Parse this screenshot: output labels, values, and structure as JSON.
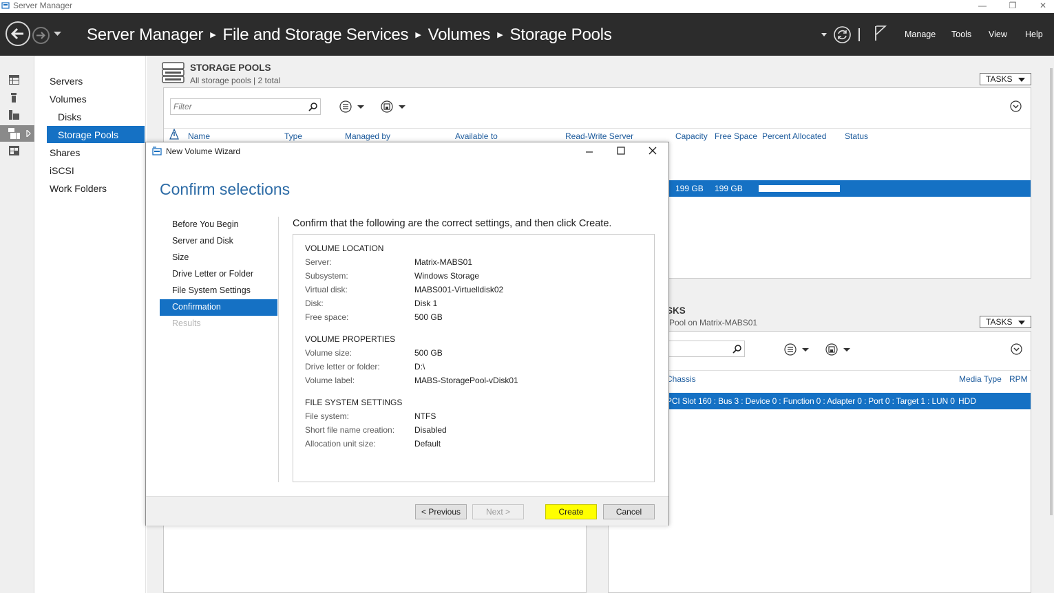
{
  "window": {
    "title": "Server Manager",
    "controls": [
      "—",
      "❐",
      "✕"
    ]
  },
  "header": {
    "breadcrumb": [
      "Server Manager",
      "File and Storage Services",
      "Volumes",
      "Storage Pools"
    ],
    "menus": [
      "Manage",
      "Tools",
      "View",
      "Help"
    ]
  },
  "nav": {
    "items": [
      "Servers",
      "Volumes",
      "Disks",
      "Storage Pools",
      "Shares",
      "iSCSI",
      "Work Folders"
    ],
    "selected": "Storage Pools"
  },
  "storage_pools": {
    "title": "STORAGE POOLS",
    "subtitle": "All storage pools | 2 total",
    "tasks_label": "TASKS",
    "filter_placeholder": "Filter",
    "columns": [
      "Name",
      "Type",
      "Managed by",
      "Available to",
      "Read-Write Server",
      "Capacity",
      "Free Space",
      "Percent Allocated",
      "Status"
    ],
    "selected_row": {
      "capacity": "199 GB",
      "free_space": "199 GB",
      "percent_allocated": 1.0
    }
  },
  "physical_disks": {
    "title_fragment": "SKS",
    "subtitle_fragment": "Pool on Matrix-MABS01",
    "tasks_label": "TASKS",
    "columns": [
      "Chassis",
      "Media Type",
      "RPM"
    ],
    "row": {
      "chassis": "PCI Slot 160 : Bus 3 : Device 0 : Function 0 : Adapter 0 : Port 0 : Target 1 : LUN 0",
      "media_type": "HDD"
    }
  },
  "dialog": {
    "title": "New Volume Wizard",
    "heading": "Confirm selections",
    "steps": [
      "Before You Begin",
      "Server and Disk",
      "Size",
      "Drive Letter or Folder",
      "File System Settings",
      "Confirmation",
      "Results"
    ],
    "current_step": "Confirmation",
    "instruction": "Confirm that the following are the correct settings, and then click Create.",
    "sections": [
      {
        "heading": "VOLUME LOCATION",
        "rows": [
          {
            "key": "Server:",
            "value": "Matrix-MABS01"
          },
          {
            "key": "Subsystem:",
            "value": "Windows Storage"
          },
          {
            "key": "Virtual disk:",
            "value": "MABS001-Virtuelldisk02"
          },
          {
            "key": "Disk:",
            "value": "Disk 1"
          },
          {
            "key": "Free space:",
            "value": "500 GB"
          }
        ]
      },
      {
        "heading": "VOLUME PROPERTIES",
        "rows": [
          {
            "key": "Volume size:",
            "value": "500 GB"
          },
          {
            "key": "Drive letter or folder:",
            "value": "D:\\"
          },
          {
            "key": "Volume label:",
            "value": "MABS-StoragePool-vDisk01"
          }
        ]
      },
      {
        "heading": "FILE SYSTEM SETTINGS",
        "rows": [
          {
            "key": "File system:",
            "value": "NTFS"
          },
          {
            "key": "Short file name creation:",
            "value": "Disabled"
          },
          {
            "key": "Allocation unit size:",
            "value": "Default"
          }
        ]
      }
    ],
    "buttons": {
      "previous": "< Previous",
      "next": "Next >",
      "create": "Create",
      "cancel": "Cancel"
    }
  },
  "colors": {
    "header_bg": "#2c2c2c",
    "selection": "#1571c4",
    "heading_blue": "#2b6aa5",
    "highlight": "#ffff00"
  }
}
